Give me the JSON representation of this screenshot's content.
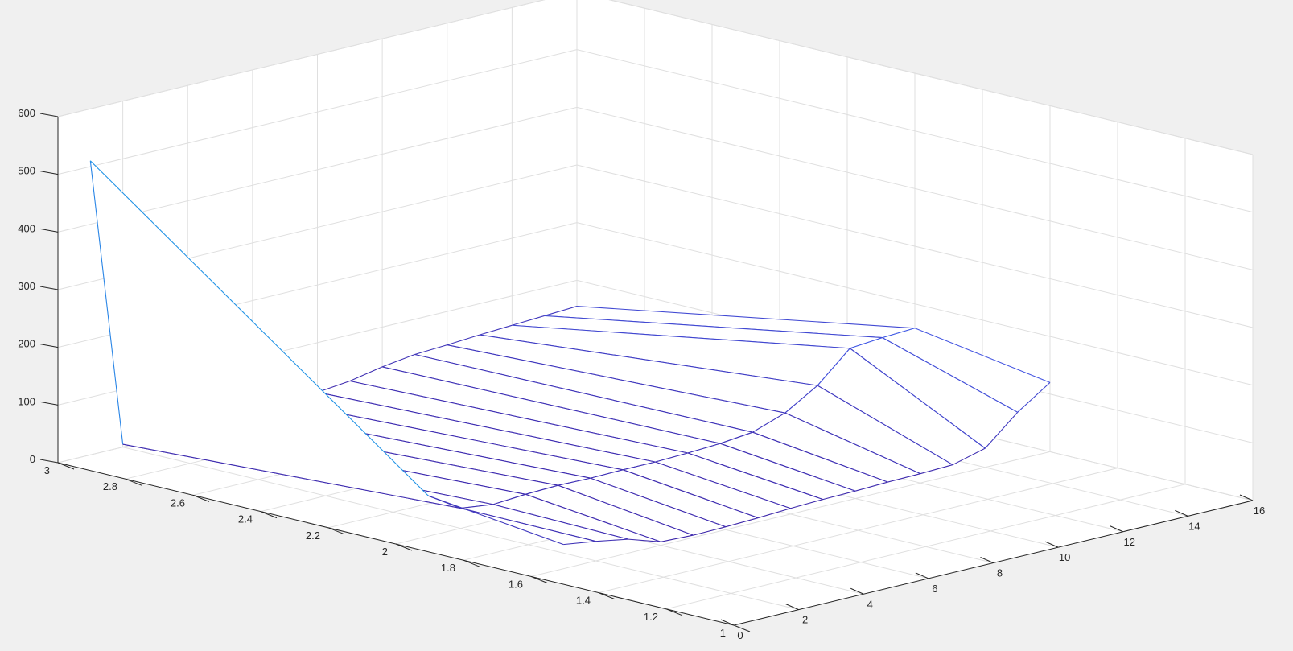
{
  "chart_data": {
    "type": "surface",
    "title": "",
    "xlabel": "",
    "ylabel": "",
    "zlabel": "",
    "grid": true,
    "background": "#f0f0f0",
    "pane_color": "#ffffff",
    "grid_color": "#dfdfdf",
    "axis_color": "#262626",
    "colormap": [
      "#3e26a8",
      "#4358e5",
      "#1f97e6",
      "#2cb7b7",
      "#f9fb15"
    ],
    "xlim": [
      0,
      16
    ],
    "ylim": [
      1,
      3
    ],
    "zlim": [
      0,
      600
    ],
    "x_ticks": [
      "0",
      "2",
      "4",
      "6",
      "8",
      "10",
      "12",
      "14",
      "16"
    ],
    "y_ticks": [
      "1",
      "1.2",
      "1.4",
      "1.6",
      "1.8",
      "2",
      "2.2",
      "2.4",
      "2.6",
      "2.8",
      "3"
    ],
    "z_ticks": [
      "0",
      "100",
      "200",
      "300",
      "400",
      "500",
      "600"
    ],
    "x_values": [
      1,
      2,
      3,
      4,
      5,
      6,
      7,
      8,
      9,
      10,
      11,
      12,
      13,
      14,
      15,
      16
    ],
    "y_values": [
      1.6,
      2.0,
      3.0
    ],
    "z_values": [
      [
        42,
        34,
        24,
        6,
        4,
        5,
        7,
        10,
        12,
        13,
        15,
        16,
        18,
        33,
        82,
        120
      ],
      [
        70,
        35,
        28,
        32,
        34,
        33,
        34,
        34,
        36,
        39,
        45,
        65,
        99,
        150,
        155,
        158
      ],
      [
        510,
        5,
        5,
        5,
        6,
        8,
        10,
        14,
        20,
        31,
        39,
        42,
        46,
        49,
        52,
        55
      ]
    ]
  }
}
